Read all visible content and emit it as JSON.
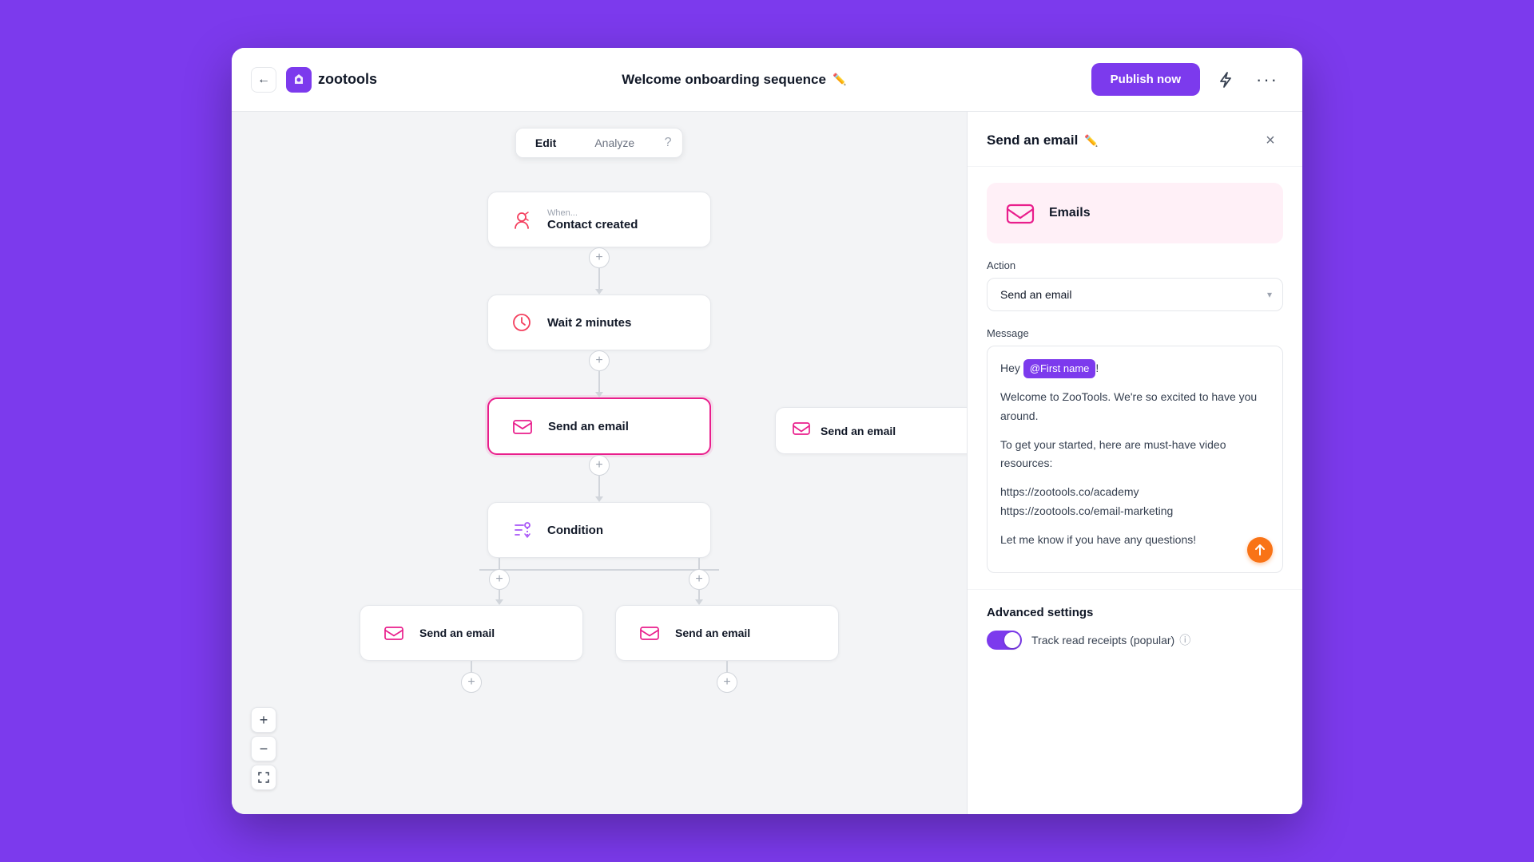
{
  "app": {
    "name": "zootools",
    "back_label": "←"
  },
  "header": {
    "title": "Welcome onboarding sequence",
    "edit_icon": "✏️",
    "publish_label": "Publish now",
    "lightning_icon": "⚡",
    "more_icon": "···"
  },
  "tabs": {
    "edit_label": "Edit",
    "analyze_label": "Analyze",
    "help_icon": "?"
  },
  "flow": {
    "trigger_small": "When...",
    "trigger_label": "Contact created",
    "wait_label": "Wait 2 minutes",
    "send_email_main": "Send an email",
    "condition_label": "Condition",
    "send_email_left": "Send an email",
    "send_email_right": "Send an email",
    "send_email_far_right": "Send an email"
  },
  "zoom": {
    "plus": "+",
    "minus": "−",
    "fit": "⛶"
  },
  "panel": {
    "title": "Send an email",
    "edit_icon": "✏️",
    "close_icon": "×",
    "email_section_label": "Emails",
    "action_label": "Action",
    "action_value": "Send an email",
    "message_label": "Message",
    "message_greeting": "Hey ",
    "first_name_tag": "@First name",
    "message_exclaim": "!",
    "message_line1": "Welcome to ZooTools. We're so excited to have you around.",
    "message_line2": "To get your started, here are must-have video resources:",
    "message_link1": "https://zootools.co/academy",
    "message_link2": "https://zootools.co/email-marketing",
    "message_line3": "Let me know if you have any questions!",
    "send_icon": "↑",
    "advanced_title": "Advanced settings",
    "toggle_label": "Track read receipts (popular)",
    "info_icon": "ⓘ"
  }
}
